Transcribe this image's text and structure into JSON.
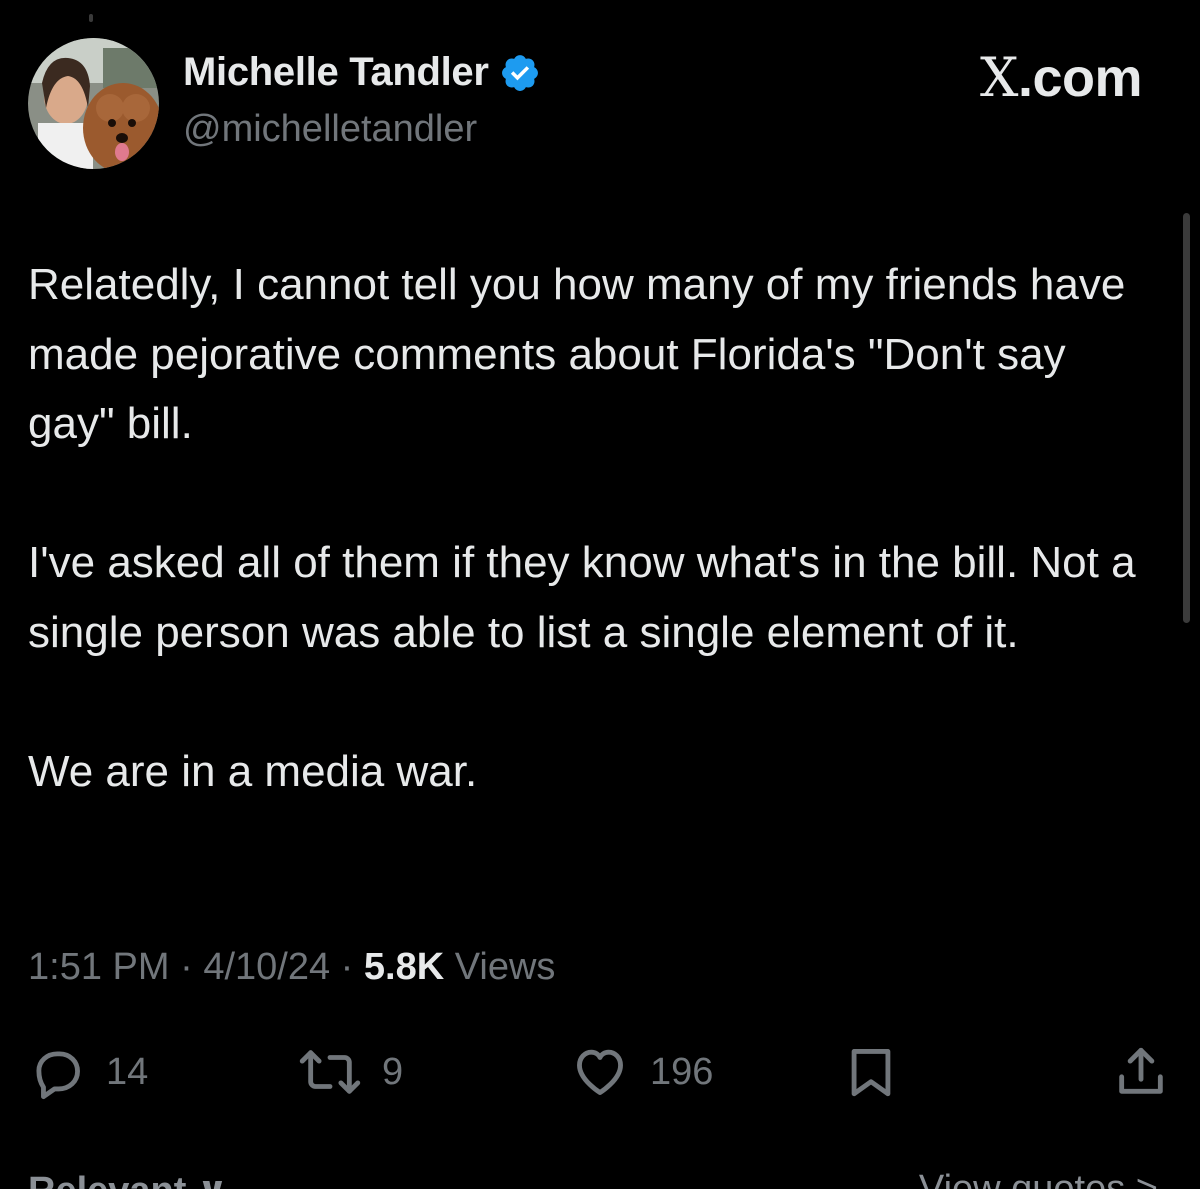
{
  "author": {
    "name": "Michelle Tandler",
    "handle": "@michelletandler",
    "verified_color": "#1d9bf0"
  },
  "brand": {
    "x": "X",
    "suffix": ".com"
  },
  "tweet": {
    "paragraph_1": "Relatedly, I cannot tell you how many of my friends have made pejorative comments about Florida's \"Don't say gay\" bill.",
    "paragraph_2": "I've asked all of them if they know what's in the bill. Not a single person was able to list a single element of it.",
    "paragraph_3": "We are in a media war."
  },
  "meta": {
    "time": "1:51 PM",
    "separator": "·",
    "date": "4/10/24",
    "views_count": "5.8K",
    "views_label": "Views"
  },
  "actions": {
    "replies": "14",
    "reposts": "9",
    "likes": "196"
  },
  "footer": {
    "left": "Relevant ∨",
    "right": "View quotes >"
  },
  "icons": [
    "verified-badge-icon",
    "reply-icon",
    "repost-icon",
    "like-icon",
    "bookmark-icon",
    "share-icon"
  ]
}
